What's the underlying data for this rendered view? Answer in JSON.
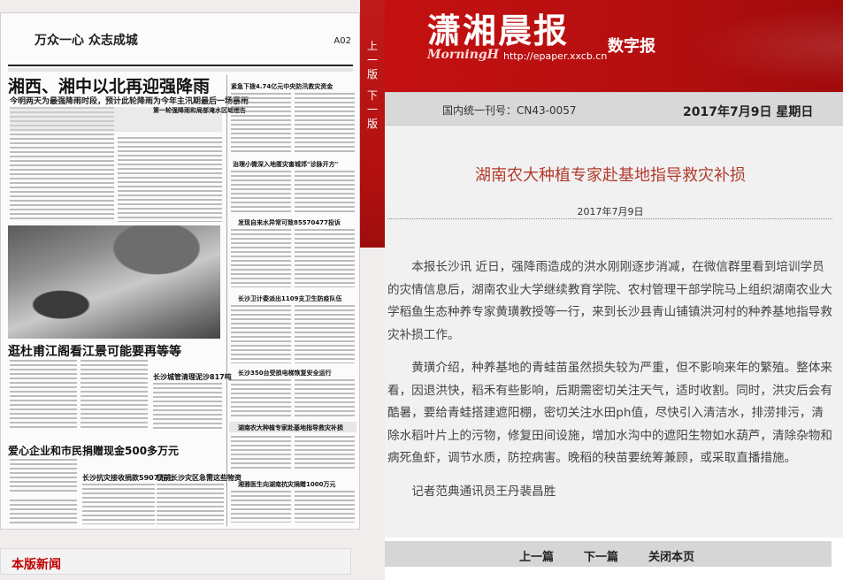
{
  "newspaper_page": {
    "slogan": "万众一心  众志成城",
    "page_number": "A02",
    "headline_main": "湘西、湘中以北再迎强降雨",
    "subheadline_main": "今明两天为最强降雨时段，预计此轮降雨为今年主汛期最后一场暴雨",
    "headline_second": "逛杜甫江阁看江景可能要再等等",
    "headline_third": "爱心企业和市民捐赠现金500多万元",
    "mid_titles": [
      "紧急下拨4.74亿元中央防汛救灾资金",
      "治理小微深入地匿灾害城郊\"诊脉开方\"",
      "发现自来水异常可致85570477投诉",
      "长沙卫计委派出1109支卫生防疫队伍",
      "长沙350台受损电梯恢复安全运行",
      "湖南农大种植专家赴基地指导救灾补损",
      "湘雅医生向湖南抗灾捐赠1000万元"
    ],
    "small_titles": [
      "第一轮强降雨和局部淹水区域缓告",
      "长沙城管清理泥沙817吨",
      "长沙抗灾接收捐款5907万元",
      "目前长沙灾区急需这些物资"
    ]
  },
  "pager": {
    "prev": [
      "上",
      "一",
      "版"
    ],
    "next": [
      "下",
      "一",
      "版"
    ]
  },
  "section_link": "本版新闻",
  "header": {
    "logo_cn": "潇湘晨报",
    "logo_en": "MorningH",
    "url": "http://epaper.xxcb.cn",
    "digital_label": "数字报"
  },
  "infobar": {
    "cn_label": "国内统一刊号：CN43-0057",
    "date": "2017年7月9日 星期日"
  },
  "article": {
    "title": "湖南农大种植专家赴基地指导救灾补损",
    "date": "2017年7月9日",
    "paragraphs": [
      "本报长沙讯  近日，强降雨造成的洪水刚刚逐步消减，在微信群里看到培训学员的灾情信息后，湖南农业大学继续教育学院、农村管理干部学院马上组织湖南农业大学稻鱼生态种养专家黄璜教授等一行，来到长沙县青山铺镇洪河村的种养基地指导救灾补损工作。",
      "黄璜介绍，种养基地的青蛙苗虽然损失较为严重，但不影响来年的繁殖。整体来看，因退洪快，稻禾有些影响，后期需密切关注天气，适时收割。同时，洪灾后会有酷暑，要给青蛙搭建遮阳棚，密切关注水田ph值，尽快引入清洁水，排涝排污，清除水稻叶片上的污物，修复田间设施，增加水沟中的遮阳生物如水葫芦，清除杂物和病死鱼虾，调节水质，防控病害。晚稻的秧苗要统筹兼顾，或采取直播措施。",
      "记者范典通讯员王丹裴昌胜"
    ]
  },
  "bottom_nav": {
    "prev": "上一篇",
    "next": "下一篇",
    "close": "关闭本页"
  },
  "colors": {
    "brand_red": "#c41010",
    "title_red": "#b23a2c",
    "link_red": "#c00000"
  }
}
